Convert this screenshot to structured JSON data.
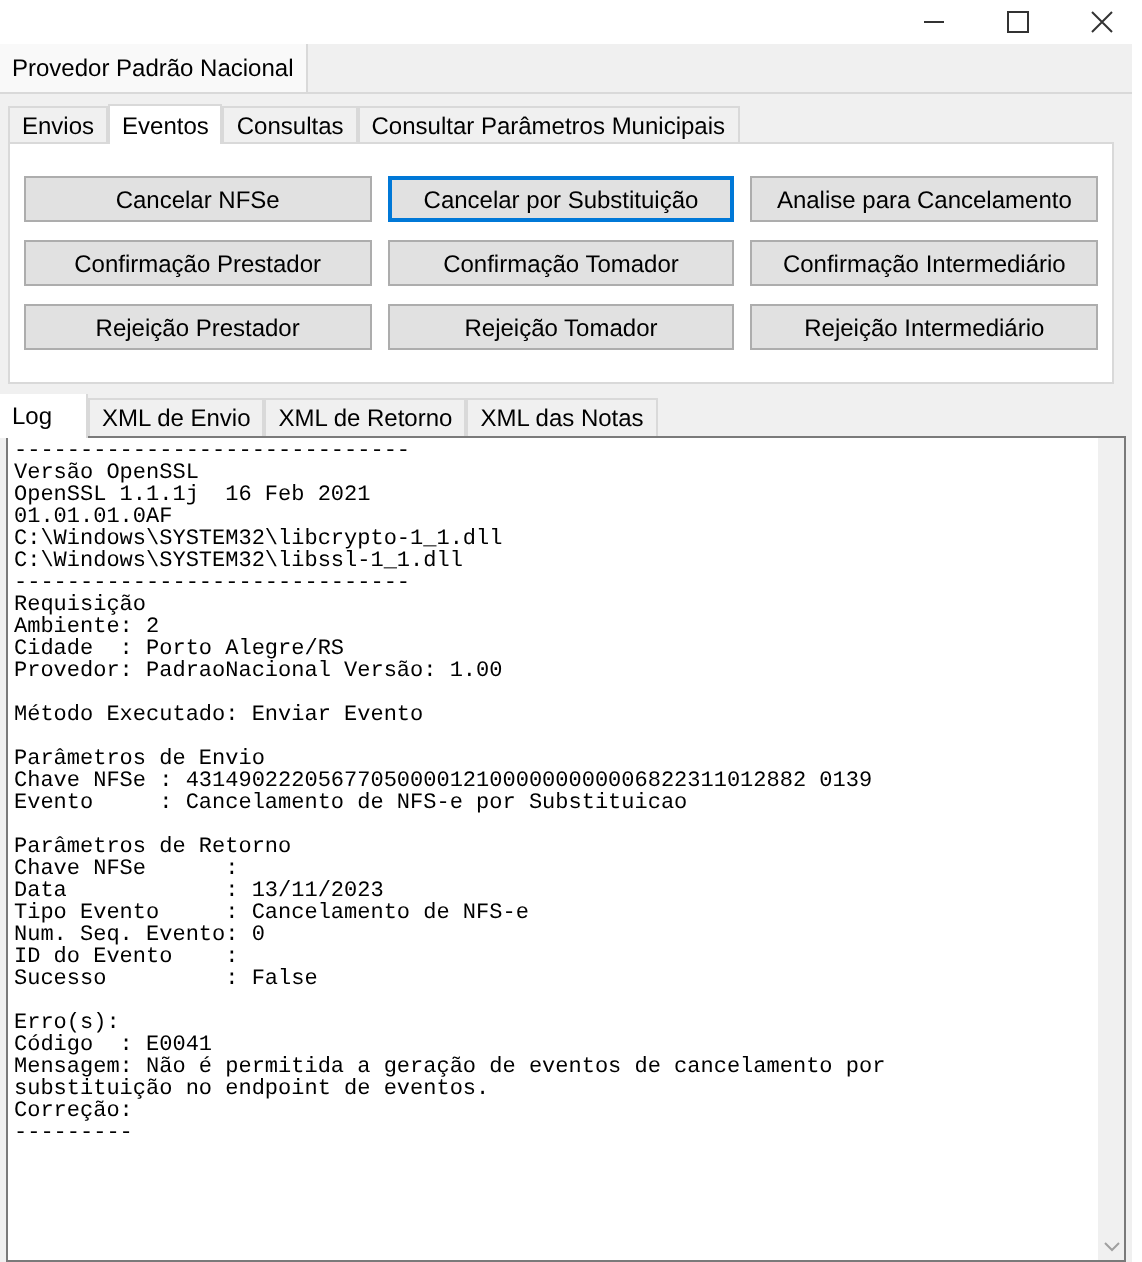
{
  "group_tab": {
    "label": "Provedor Padrão Nacional"
  },
  "tabs": [
    {
      "label": "Envios",
      "selected": false
    },
    {
      "label": "Eventos",
      "selected": true
    },
    {
      "label": "Consultas",
      "selected": false
    },
    {
      "label": "Consultar Parâmetros Municipais",
      "selected": false
    }
  ],
  "buttons": [
    {
      "label": "Cancelar NFSe",
      "focused": false
    },
    {
      "label": "Cancelar por Substituição",
      "focused": true
    },
    {
      "label": "Analise para Cancelamento",
      "focused": false
    },
    {
      "label": "Confirmação Prestador",
      "focused": false
    },
    {
      "label": "Confirmação Tomador",
      "focused": false
    },
    {
      "label": "Confirmação Intermediário",
      "focused": false
    },
    {
      "label": "Rejeição Prestador",
      "focused": false
    },
    {
      "label": "Rejeição Tomador",
      "focused": false
    },
    {
      "label": "Rejeição Intermediário",
      "focused": false
    }
  ],
  "output_tabs": [
    {
      "label": "Log",
      "selected": true
    },
    {
      "label": "XML de Envio",
      "selected": false
    },
    {
      "label": "XML de Retorno",
      "selected": false
    },
    {
      "label": "XML das Notas",
      "selected": false
    }
  ],
  "log": {
    "blocks": [
      [
        "------------------------------",
        "Versão OpenSSL",
        "OpenSSL 1.1.1j  16 Feb 2021",
        "01.01.01.0AF",
        "C:\\Windows\\SYSTEM32\\libcrypto-1_1.dll",
        "C:\\Windows\\SYSTEM32\\libssl-1_1.dll",
        "------------------------------",
        "Requisição",
        "Ambiente: 2",
        "Cidade  : Porto Alegre/RS",
        "Provedor: PadraoNacional Versão: 1.00"
      ],
      [
        "Método Executado: Enviar Evento"
      ],
      [
        "Parâmetros de Envio",
        "Chave NFSe : 43149022205677050000121000000000006822311012882 0139",
        "Evento     : Cancelamento de NFS-e por Substituicao"
      ],
      [
        "Parâmetros de Retorno",
        "Chave NFSe      :",
        "Data            : 13/11/2023",
        "Tipo Evento     : Cancelamento de NFS-e",
        "Num. Seq. Evento: 0",
        "ID do Evento    :",
        "Sucesso         : False"
      ],
      [
        "Erro(s):",
        "Código  : E0041",
        "Mensagem: Não é permitida a geração de eventos de cancelamento por",
        "substituição no endpoint de eventos.",
        "Correção:",
        "---------"
      ]
    ]
  }
}
